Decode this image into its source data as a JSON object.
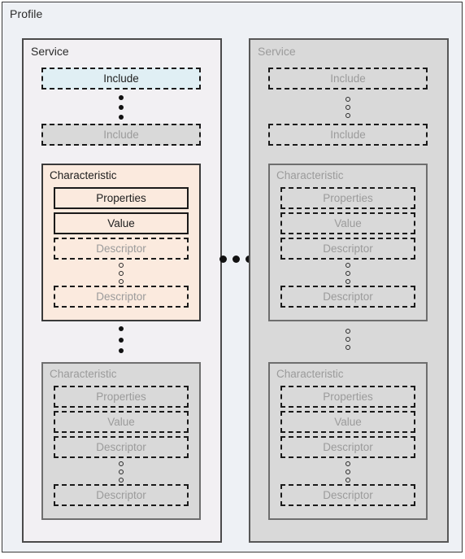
{
  "diagram": {
    "type": "nested-block-diagram",
    "profile": {
      "label": "Profile"
    },
    "separator": {
      "name": "horizontal-ellipsis",
      "dots": 3,
      "style": "filled"
    },
    "columns": [
      {
        "id": "service-active",
        "state": "active",
        "label": "Service",
        "includes": [
          {
            "label": "Include",
            "state": "active",
            "fill": "#e0eff4",
            "border": "dashed"
          },
          {
            "label": "Include",
            "state": "ghost",
            "fill": "#d9d9d9",
            "border": "dashed"
          }
        ],
        "include_ellipsis": {
          "dots": 3,
          "style": "filled"
        },
        "characteristics": [
          {
            "label": "Characteristic",
            "state": "active",
            "fill": "#fbeade",
            "properties": {
              "label": "Properties",
              "border": "solid"
            },
            "value": {
              "label": "Value",
              "border": "solid"
            },
            "descriptors": [
              {
                "label": "Descriptor",
                "border": "dashed"
              },
              {
                "label": "Descriptor",
                "border": "dashed"
              }
            ],
            "descriptor_ellipsis": {
              "dots": 3,
              "style": "hollow"
            }
          },
          {
            "label": "Characteristic",
            "state": "ghost",
            "fill": "#d9d9d9",
            "properties": {
              "label": "Properties",
              "border": "dashed"
            },
            "value": {
              "label": "Value",
              "border": "dashed"
            },
            "descriptors": [
              {
                "label": "Descriptor",
                "border": "dashed"
              },
              {
                "label": "Descriptor",
                "border": "dashed"
              }
            ],
            "descriptor_ellipsis": {
              "dots": 3,
              "style": "hollow"
            }
          }
        ],
        "characteristic_ellipsis": {
          "dots": 3,
          "style": "filled"
        }
      },
      {
        "id": "service-ghost",
        "state": "ghost",
        "label": "Service",
        "includes": [
          {
            "label": "Include",
            "state": "ghost",
            "fill": "#d9d9d9",
            "border": "dashed"
          },
          {
            "label": "Include",
            "state": "ghost",
            "fill": "#d9d9d9",
            "border": "dashed"
          }
        ],
        "include_ellipsis": {
          "dots": 3,
          "style": "hollow"
        },
        "characteristics": [
          {
            "label": "Characteristic",
            "state": "ghost",
            "fill": "#d9d9d9",
            "properties": {
              "label": "Properties",
              "border": "dashed"
            },
            "value": {
              "label": "Value",
              "border": "dashed"
            },
            "descriptors": [
              {
                "label": "Descriptor",
                "border": "dashed"
              },
              {
                "label": "Descriptor",
                "border": "dashed"
              }
            ],
            "descriptor_ellipsis": {
              "dots": 3,
              "style": "hollow"
            }
          },
          {
            "label": "Characteristic",
            "state": "ghost",
            "fill": "#d9d9d9",
            "properties": {
              "label": "Properties",
              "border": "dashed"
            },
            "value": {
              "label": "Value",
              "border": "dashed"
            },
            "descriptors": [
              {
                "label": "Descriptor",
                "border": "dashed"
              },
              {
                "label": "Descriptor",
                "border": "dashed"
              }
            ],
            "descriptor_ellipsis": {
              "dots": 3,
              "style": "hollow"
            }
          }
        ],
        "characteristic_ellipsis": {
          "dots": 3,
          "style": "hollow"
        }
      }
    ],
    "colors": {
      "page_background": "#ffffff",
      "profile_background": "#eef1f5",
      "service_active_background": "#f2f0f3",
      "ghost_background": "#d9d9d9",
      "include_highlight": "#e0eff4",
      "characteristic_highlight": "#fbeade",
      "text_active": "#202020",
      "text_ghost": "#9b9b9b",
      "border_dark": "#1a1a1a"
    }
  }
}
